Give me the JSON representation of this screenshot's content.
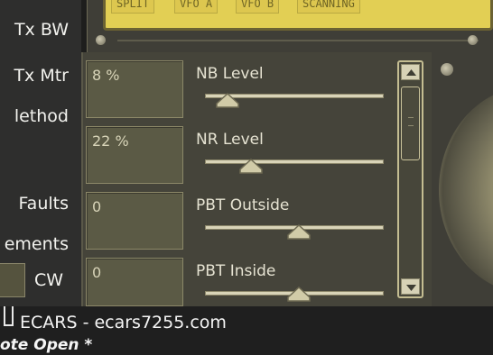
{
  "left_labels": {
    "tx_bw": "Tx BW",
    "tx_mtr": "Tx Mtr",
    "method": "lethod",
    "faults": "Faults",
    "elements": "ements",
    "cw": "CW"
  },
  "vfo_buttons": [
    "SPLIT",
    "VFO A",
    "VFO B",
    "SCANNING"
  ],
  "controls": [
    {
      "label": "NB Level",
      "value": "8 %",
      "level_percent": 8
    },
    {
      "label": "NR Level",
      "value": "22 %",
      "level_percent": 22
    },
    {
      "label": "PBT Outside",
      "value": "0",
      "level_percent": 50
    },
    {
      "label": "PBT Inside",
      "value": "0",
      "level_percent": 50
    }
  ],
  "scrollbar": {
    "up_icon": "triangle-up",
    "down_icon": "triangle-down",
    "position_fraction": 0.12
  },
  "bottom": {
    "app_title": "ECARS - ecars7255.com",
    "status": "ote Open *"
  },
  "colors": {
    "display_yellow": "#e2cf54",
    "panel_olive": "#45443a",
    "accent_cream": "#d9d4b8"
  }
}
